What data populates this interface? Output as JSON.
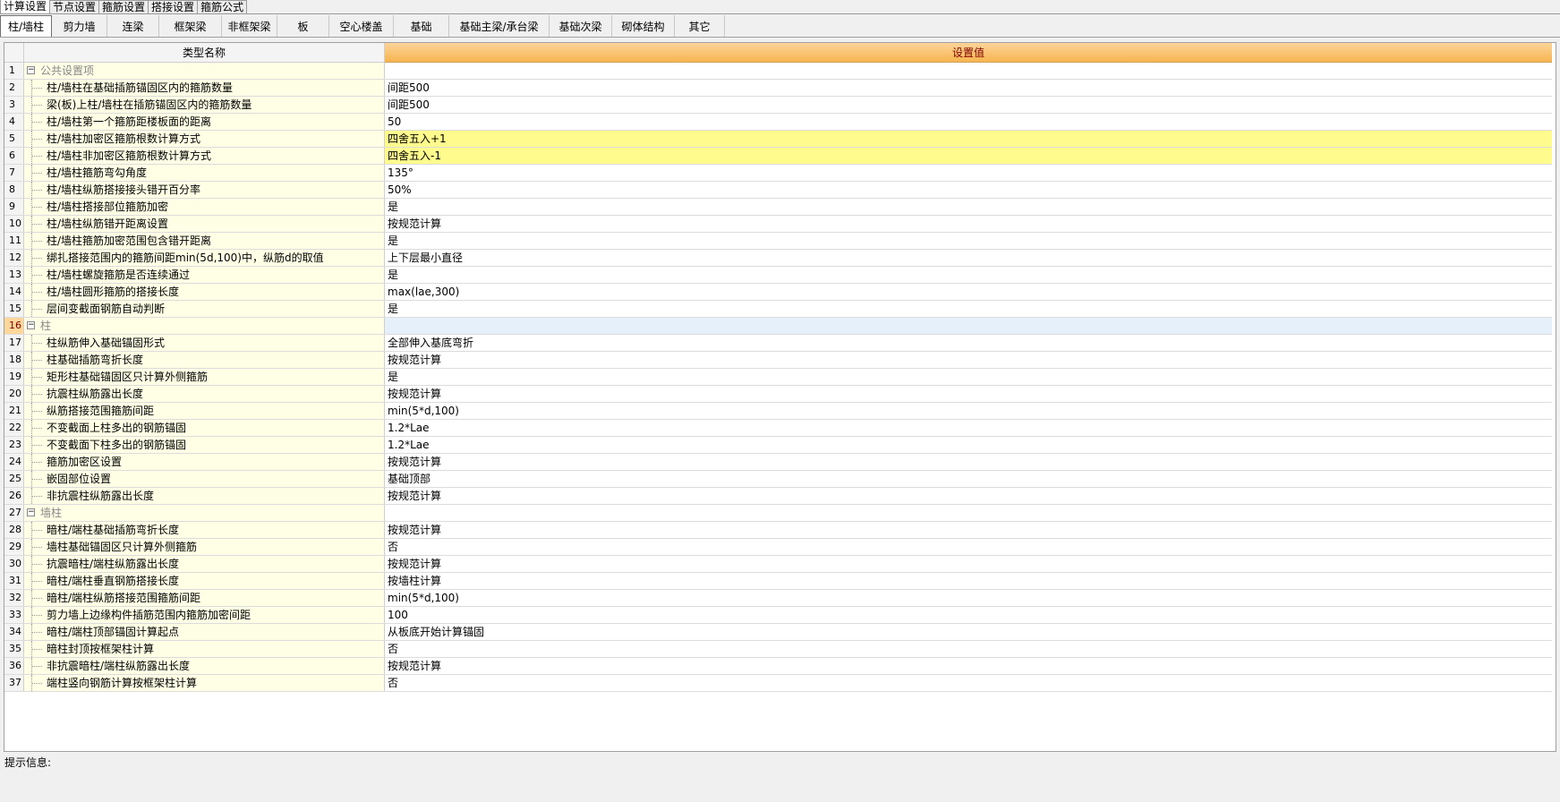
{
  "top_tabs": [
    {
      "label": "计算设置",
      "active": true
    },
    {
      "label": "节点设置",
      "active": false
    },
    {
      "label": "箍筋设置",
      "active": false
    },
    {
      "label": "搭接设置",
      "active": false
    },
    {
      "label": "箍筋公式",
      "active": false
    }
  ],
  "sub_tabs": [
    {
      "label": "柱/墙柱",
      "active": true,
      "w": 58
    },
    {
      "label": "剪力墙",
      "w": 62
    },
    {
      "label": "连梁",
      "w": 58
    },
    {
      "label": "框架梁",
      "w": 70
    },
    {
      "label": "非框架梁",
      "w": 62
    },
    {
      "label": "板",
      "w": 58
    },
    {
      "label": "空心楼盖",
      "w": 72
    },
    {
      "label": "基础",
      "w": 62
    },
    {
      "label": "基础主梁/承台梁",
      "w": 112
    },
    {
      "label": "基础次梁",
      "w": 70
    },
    {
      "label": "砌体结构",
      "w": 70
    },
    {
      "label": "其它",
      "w": 56
    }
  ],
  "grid": {
    "header_name": "类型名称",
    "header_value": "设置值",
    "rows": [
      {
        "num": "1",
        "name": "公共设置项",
        "value": "",
        "group": true
      },
      {
        "num": "2",
        "name": "柱/墙柱在基础插筋锚固区内的箍筋数量",
        "value": "间距500"
      },
      {
        "num": "3",
        "name": "梁(板)上柱/墙柱在插筋锚固区内的箍筋数量",
        "value": "间距500"
      },
      {
        "num": "4",
        "name": "柱/墙柱第一个箍筋距楼板面的距离",
        "value": "50"
      },
      {
        "num": "5",
        "name": "柱/墙柱加密区箍筋根数计算方式",
        "value": "四舍五入+1",
        "hl": true
      },
      {
        "num": "6",
        "name": "柱/墙柱非加密区箍筋根数计算方式",
        "value": "四舍五入-1",
        "hl": true
      },
      {
        "num": "7",
        "name": "柱/墙柱箍筋弯勾角度",
        "value": "135°"
      },
      {
        "num": "8",
        "name": "柱/墙柱纵筋搭接接头错开百分率",
        "value": "50%"
      },
      {
        "num": "9",
        "name": "柱/墙柱搭接部位箍筋加密",
        "value": "是"
      },
      {
        "num": "10",
        "name": "柱/墙柱纵筋错开距离设置",
        "value": "按规范计算"
      },
      {
        "num": "11",
        "name": "柱/墙柱箍筋加密范围包含错开距离",
        "value": "是"
      },
      {
        "num": "12",
        "name": "绑扎搭接范围内的箍筋间距min(5d,100)中，纵筋d的取值",
        "value": "上下层最小直径"
      },
      {
        "num": "13",
        "name": "柱/墙柱螺旋箍筋是否连续通过",
        "value": "是"
      },
      {
        "num": "14",
        "name": "柱/墙柱圆形箍筋的搭接长度",
        "value": "max(lae,300)"
      },
      {
        "num": "15",
        "name": "层间变截面钢筋自动判断",
        "value": "是"
      },
      {
        "num": "16",
        "name": "柱",
        "value": "",
        "group": true,
        "sel": true
      },
      {
        "num": "17",
        "name": "柱纵筋伸入基础锚固形式",
        "value": "全部伸入基底弯折"
      },
      {
        "num": "18",
        "name": "柱基础插筋弯折长度",
        "value": "按规范计算"
      },
      {
        "num": "19",
        "name": "矩形柱基础锚固区只计算外侧箍筋",
        "value": "是"
      },
      {
        "num": "20",
        "name": "抗震柱纵筋露出长度",
        "value": "按规范计算"
      },
      {
        "num": "21",
        "name": "纵筋搭接范围箍筋间距",
        "value": "min(5*d,100)"
      },
      {
        "num": "22",
        "name": "不变截面上柱多出的钢筋锚固",
        "value": "1.2*Lae"
      },
      {
        "num": "23",
        "name": "不变截面下柱多出的钢筋锚固",
        "value": "1.2*Lae"
      },
      {
        "num": "24",
        "name": "箍筋加密区设置",
        "value": "按规范计算"
      },
      {
        "num": "25",
        "name": "嵌固部位设置",
        "value": "基础顶部"
      },
      {
        "num": "26",
        "name": "非抗震柱纵筋露出长度",
        "value": "按规范计算"
      },
      {
        "num": "27",
        "name": "墙柱",
        "value": "",
        "group": true
      },
      {
        "num": "28",
        "name": "暗柱/端柱基础插筋弯折长度",
        "value": "按规范计算"
      },
      {
        "num": "29",
        "name": "墙柱基础锚固区只计算外侧箍筋",
        "value": "否"
      },
      {
        "num": "30",
        "name": "抗震暗柱/端柱纵筋露出长度",
        "value": "按规范计算"
      },
      {
        "num": "31",
        "name": "暗柱/端柱垂直钢筋搭接长度",
        "value": "按墙柱计算"
      },
      {
        "num": "32",
        "name": "暗柱/端柱纵筋搭接范围箍筋间距",
        "value": "min(5*d,100)"
      },
      {
        "num": "33",
        "name": "剪力墙上边缘构件插筋范围内箍筋加密间距",
        "value": "100"
      },
      {
        "num": "34",
        "name": "暗柱/端柱顶部锚固计算起点",
        "value": "从板底开始计算锚固"
      },
      {
        "num": "35",
        "name": "暗柱封顶按框架柱计算",
        "value": "否"
      },
      {
        "num": "36",
        "name": "非抗震暗柱/端柱纵筋露出长度",
        "value": "按规范计算"
      },
      {
        "num": "37",
        "name": "端柱竖向钢筋计算按框架柱计算",
        "value": "否"
      }
    ]
  },
  "hint_label": "提示信息:",
  "expand_glyph": "−"
}
